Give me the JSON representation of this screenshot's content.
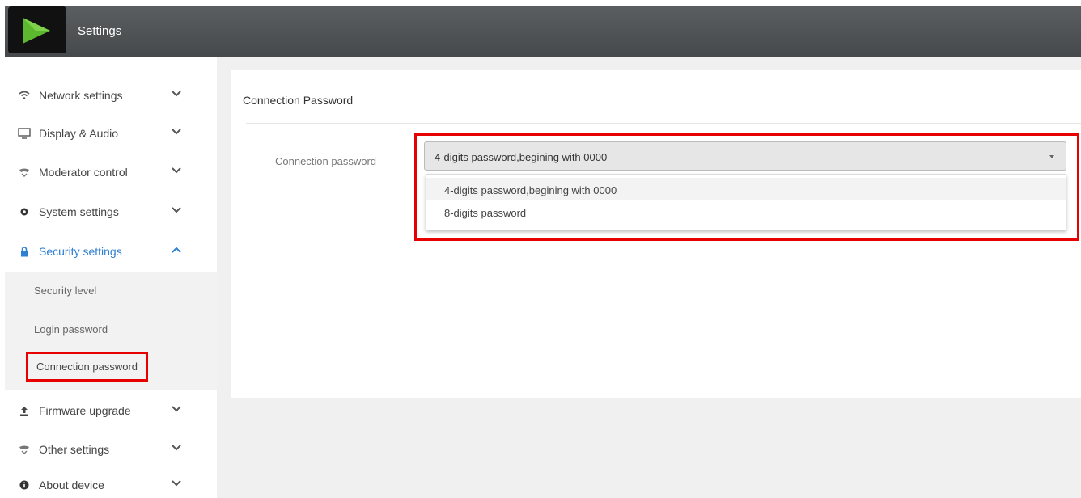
{
  "header": {
    "title": "Settings",
    "logo_icon": "play-logo-icon",
    "colors": {
      "bar": "#4f5254",
      "logo_green": "#5cb82e"
    }
  },
  "sidebar": {
    "items": [
      {
        "label": "Network settings",
        "icon": "wifi-icon",
        "chevron": "down"
      },
      {
        "label": "Display & Audio",
        "icon": "monitor-icon",
        "chevron": "down"
      },
      {
        "label": "Moderator control",
        "icon": "moderator-icon",
        "chevron": "down"
      },
      {
        "label": "System settings",
        "icon": "gear-icon",
        "chevron": "down"
      },
      {
        "label": "Security settings",
        "icon": "lock-icon",
        "chevron": "up",
        "active": true
      },
      {
        "label": "Firmware upgrade",
        "icon": "upload-icon",
        "chevron": "down"
      },
      {
        "label": "Other settings",
        "icon": "other-icon",
        "chevron": "down"
      },
      {
        "label": "About device",
        "icon": "info-icon",
        "chevron": "down"
      }
    ],
    "security_sub_items": [
      {
        "label": "Security level"
      },
      {
        "label": "Login password"
      },
      {
        "label": "Connection password",
        "current": true
      }
    ],
    "active_color": "#2f7fd3"
  },
  "panel": {
    "title": "Connection Password",
    "field_label": "Connection password",
    "select": {
      "value": "4-digits password,begining with 0000",
      "options": [
        "4-digits password,begining with 0000",
        "8-digits password"
      ]
    },
    "highlight_color": "#e60000"
  }
}
